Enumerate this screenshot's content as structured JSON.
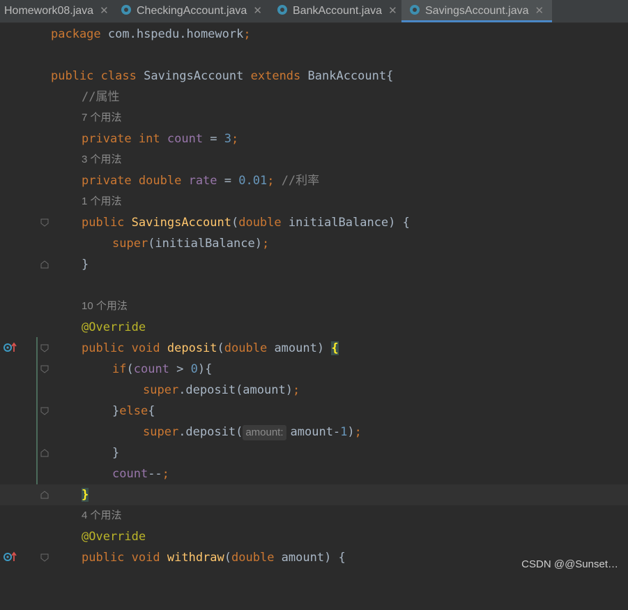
{
  "tabs": [
    {
      "label": "Homework08.java",
      "active": false,
      "icon": "java-class-icon"
    },
    {
      "label": "CheckingAccount.java",
      "active": false,
      "icon": "java-class-icon"
    },
    {
      "label": "BankAccount.java",
      "active": false,
      "icon": "java-class-icon"
    },
    {
      "label": "SavingsAccount.java",
      "active": true,
      "icon": "java-class-icon"
    }
  ],
  "code": {
    "l1": {
      "kw": "package",
      "rest": " com.hspedu.homework",
      "semi": ";"
    },
    "l3": {
      "kw1": "public",
      "kw2": "class",
      "name": " SavingsAccount ",
      "kw3": "extends",
      "rest": " BankAccount{"
    },
    "l4": "//属性",
    "h5": "7 个用法",
    "l6": {
      "kw1": "private",
      "kw2": "int",
      "field": "count",
      "op": " = ",
      "num": "3",
      "semi": ";"
    },
    "h7": "3 个用法",
    "l8": {
      "kw1": "private",
      "kw2": "double",
      "field": "rate",
      "op": " = ",
      "num": "0.01",
      "semi": ";",
      "comment": " //利率"
    },
    "h9": "1 个用法",
    "l10": {
      "kw1": "public",
      "method": "SavingsAccount",
      "open": "(",
      "kw2": "double",
      "rest": " initialBalance) {"
    },
    "l11": {
      "kw": "super",
      "rest": "(initialBalance)",
      "semi": ";"
    },
    "l12": "}",
    "h14": "10 个用法",
    "l15": "@Override",
    "l16": {
      "kw1": "public",
      "kw2": "void",
      "method": "deposit",
      "open": "(",
      "kw3": "double",
      "rest": " amount) ",
      "brace": "{"
    },
    "l17": {
      "kw": "if",
      "open": "(",
      "field": "count",
      "op": " > ",
      "num": "0",
      "rest": "){"
    },
    "l18": {
      "kw": "super",
      "rest": ".deposit(amount)",
      "semi": ";"
    },
    "l19": {
      "close": "}",
      "kw": "else",
      "rest": "{"
    },
    "l20": {
      "kw": "super",
      "rest": ".deposit(",
      "hint": "amount:",
      "arg": "amount-",
      "num": "1",
      "close": ")",
      "semi": ";"
    },
    "l21": "}",
    "l22": {
      "field": "count",
      "op": "--",
      "semi": ";"
    },
    "l23": "}",
    "h24": "4 个用法",
    "l25": "@Override",
    "l26": {
      "kw1": "public",
      "kw2": "void",
      "method": "withdraw",
      "open": "(",
      "kw3": "double",
      "rest": " amount) {"
    }
  },
  "watermark": "CSDN @@Sunset…"
}
